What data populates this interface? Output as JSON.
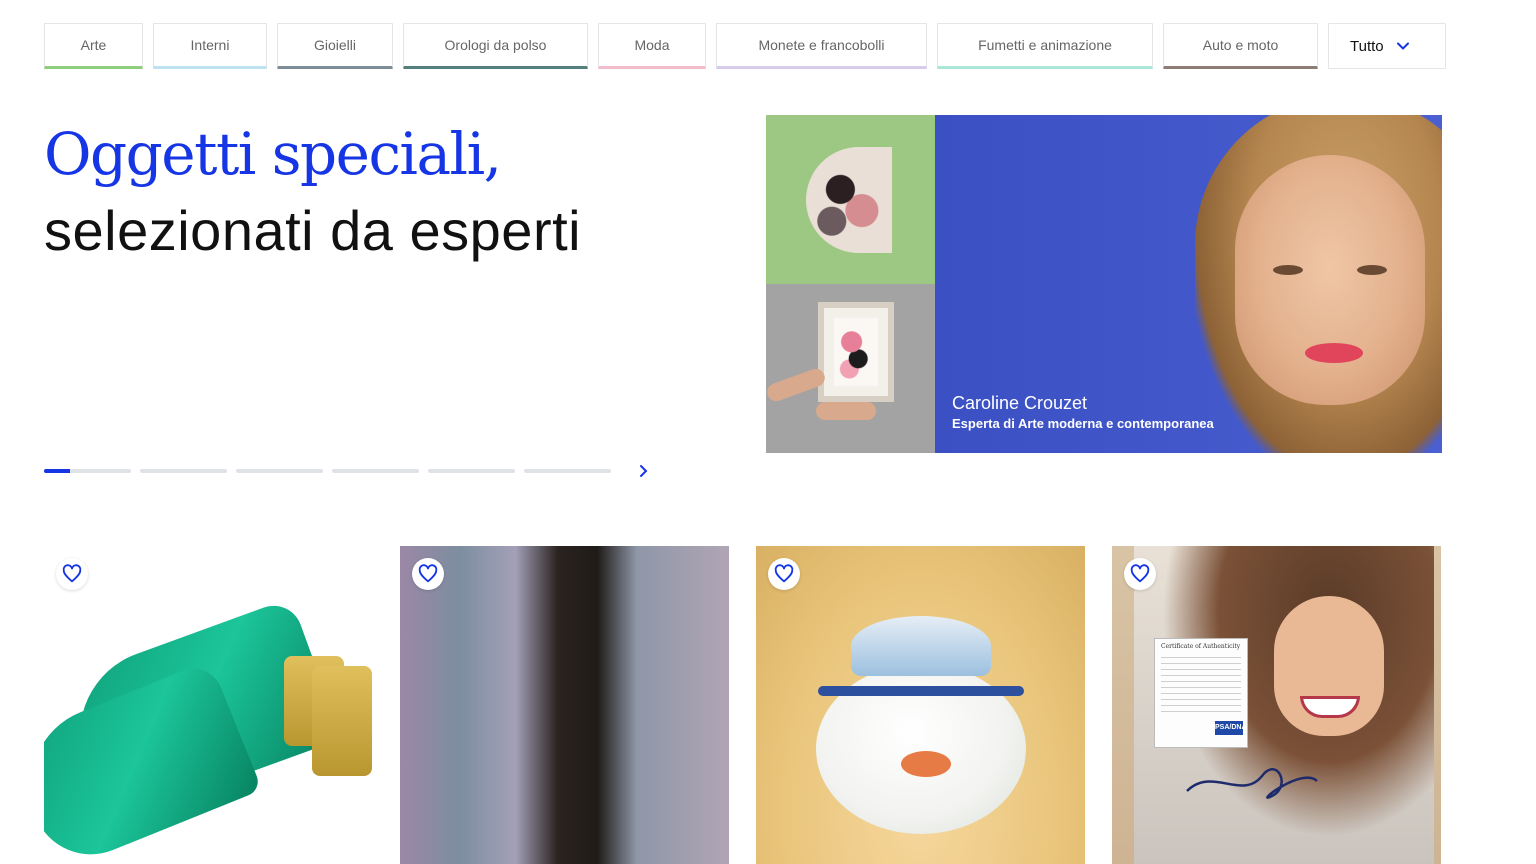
{
  "categories": [
    {
      "label": "Arte"
    },
    {
      "label": "Interni"
    },
    {
      "label": "Gioielli"
    },
    {
      "label": "Orologi da polso"
    },
    {
      "label": "Moda"
    },
    {
      "label": "Monete e francobolli"
    },
    {
      "label": "Fumetti e animazione"
    },
    {
      "label": "Auto e moto"
    }
  ],
  "all_dropdown": {
    "label": "Tutto",
    "icon": "chevron-down-icon"
  },
  "hero": {
    "title_line1": "Oggetti speciali,",
    "title_line2": "selezionati da esperti"
  },
  "carousel": {
    "segments": 6,
    "active_index": 0,
    "active_progress": 0.3,
    "next_icon": "chevron-right-icon"
  },
  "banner": {
    "expert_name": "Caroline Crouzet",
    "expert_role": "Esperta di Arte moderna e contemporanea"
  },
  "products": [
    {
      "image": "green-satin-mules",
      "favorite_icon": "heart-icon"
    },
    {
      "image": "abstract-painting",
      "favorite_icon": "heart-icon"
    },
    {
      "image": "porcelain-teapot",
      "favorite_icon": "heart-icon"
    },
    {
      "image": "signed-photo",
      "favorite_icon": "heart-icon"
    }
  ],
  "certificate": {
    "title": "Certificate of Authenticity",
    "badge": "PSA/DNA"
  },
  "colors": {
    "accent": "#1636e6",
    "banner_blue": "#3f55c7",
    "tile_green": "#9cc884",
    "tile_grey": "#a3a3a3"
  }
}
